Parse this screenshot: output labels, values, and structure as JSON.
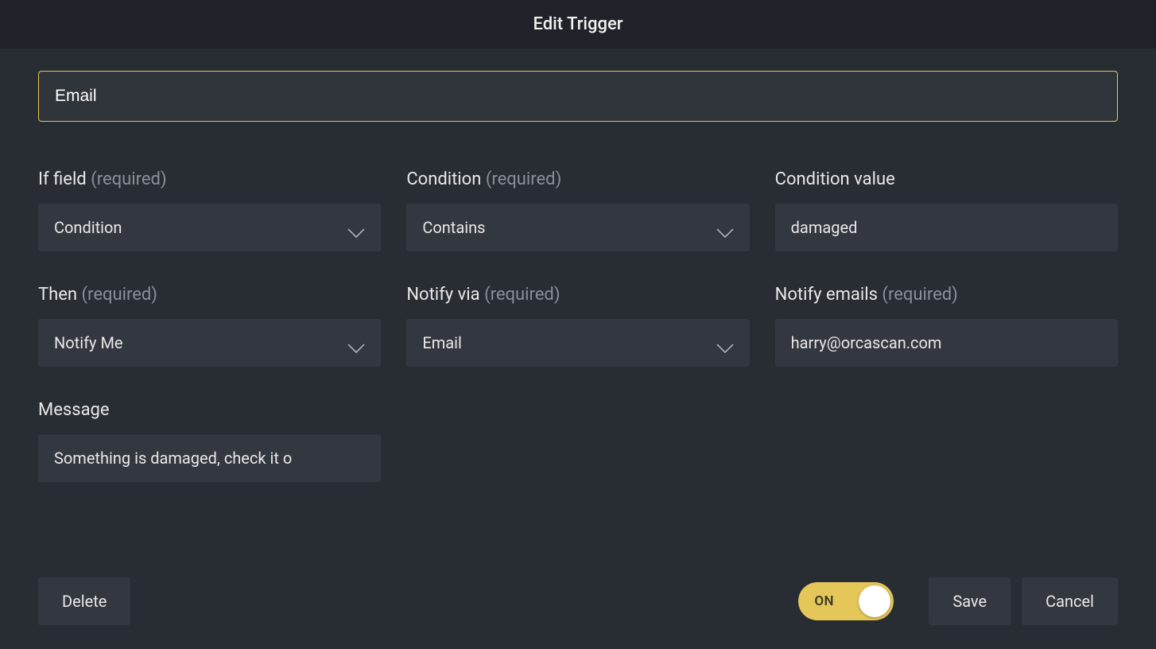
{
  "modal": {
    "title": "Edit Trigger"
  },
  "nameInput": {
    "value": "Email"
  },
  "fields": {
    "ifField": {
      "label": "If field",
      "required": "(required)",
      "value": "Condition"
    },
    "condition": {
      "label": "Condition",
      "required": "(required)",
      "value": "Contains"
    },
    "conditionValue": {
      "label": "Condition value",
      "value": "damaged"
    },
    "then": {
      "label": "Then",
      "required": "(required)",
      "value": "Notify Me"
    },
    "notifyVia": {
      "label": "Notify via",
      "required": "(required)",
      "value": "Email"
    },
    "notifyEmails": {
      "label": "Notify emails",
      "required": "(required)",
      "value": "harry@orcascan.com"
    },
    "message": {
      "label": "Message",
      "value": "Something is damaged, check it o"
    }
  },
  "toggle": {
    "label": "ON",
    "state": true
  },
  "buttons": {
    "delete": "Delete",
    "save": "Save",
    "cancel": "Cancel"
  }
}
